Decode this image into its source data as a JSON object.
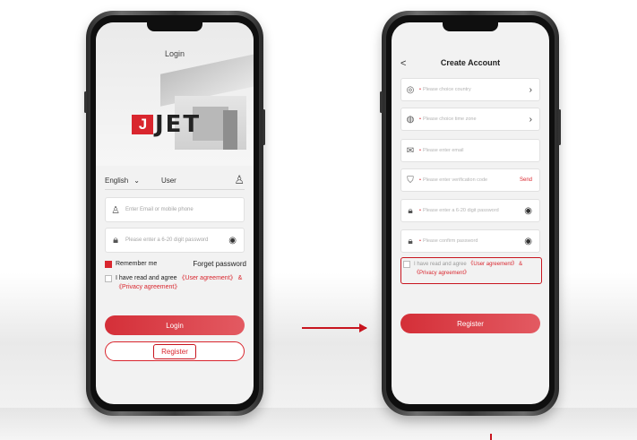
{
  "left_phone": {
    "title": "Login",
    "logo_mark": "J",
    "logo_text": "JET",
    "language": "English",
    "user_label": "User",
    "email_placeholder": "Enter Email or mobile phone",
    "password_placeholder": "Please enter a 6-20 digit password",
    "remember_label": "Remember me",
    "forget_label": "Forget password",
    "agree_prefix": "I have read and agree",
    "user_agreement": "《User agreement》",
    "amp": "&",
    "privacy_agreement": "《Privacy agreement》",
    "login_label": "Login",
    "register_label": "Register"
  },
  "right_phone": {
    "back_label": "<",
    "title": "Create Account",
    "fields": [
      {
        "placeholder": "Please choice country",
        "tail": "›"
      },
      {
        "placeholder": "Please choice time zone",
        "tail": "›"
      },
      {
        "placeholder": "Please enter email",
        "tail": ""
      },
      {
        "placeholder": "Please enter verification code",
        "tail": "Send"
      },
      {
        "placeholder": "Please enter a 6-20 digit password",
        "tail": "eye"
      },
      {
        "placeholder": "Please confirm password",
        "tail": "eye"
      }
    ],
    "agree_prefix": "I have read and agree",
    "user_agreement": "《User agreement》",
    "amp": "&",
    "privacy_agreement": "《Privacy agreement》",
    "register_label": "Register"
  },
  "colors": {
    "accent": "#d9262e",
    "annotation": "#c8151f"
  }
}
